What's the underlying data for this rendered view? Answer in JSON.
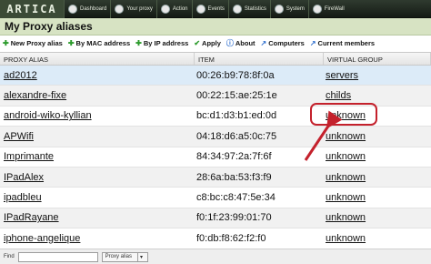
{
  "nav": {
    "logo": "ARTICA",
    "items": [
      {
        "label": "Dashboard",
        "icon": "home-icon"
      },
      {
        "label": "Your proxy",
        "icon": "proxy-icon"
      },
      {
        "label": "Action",
        "icon": "power-icon"
      },
      {
        "label": "Events",
        "icon": "eye-icon"
      },
      {
        "label": "Statistics",
        "icon": "chart-icon"
      },
      {
        "label": "System",
        "icon": "system-icon"
      },
      {
        "label": "FireWall",
        "icon": "firewall-icon"
      }
    ]
  },
  "page": {
    "title": "My Proxy aliases"
  },
  "toolbar": {
    "new_alias": "New Proxy alias",
    "by_mac": "By MAC address",
    "by_ip": "By IP address",
    "apply": "Apply",
    "about": "About",
    "computers": "Computers",
    "members": "Current members"
  },
  "table": {
    "headers": [
      "PROXY ALIAS",
      "ITEM",
      "VIRTUAL GROUP"
    ],
    "rows": [
      {
        "alias": "ad2012",
        "item": "00:26:b9:78:8f:0a",
        "group": "servers"
      },
      {
        "alias": "alexandre-fixe",
        "item": "00:22:15:ae:25:1e",
        "group": "childs"
      },
      {
        "alias": "android-wiko-kyllian",
        "item": "bc:d1:d3:b1:ed:0d",
        "group": "unknown"
      },
      {
        "alias": "APWifi",
        "item": "04:18:d6:a5:0c:75",
        "group": "unknown"
      },
      {
        "alias": "Imprimante",
        "item": "84:34:97:2a:7f:6f",
        "group": "unknown"
      },
      {
        "alias": "IPadAlex",
        "item": "28:6a:ba:53:f3:f9",
        "group": "unknown"
      },
      {
        "alias": "ipadbleu",
        "item": "c8:bc:c8:47:5e:34",
        "group": "unknown"
      },
      {
        "alias": "IPadRayane",
        "item": "f0:1f:23:99:01:70",
        "group": "unknown"
      },
      {
        "alias": "iphone-angelique",
        "item": "f0:db:f8:62:f2:f0",
        "group": "unknown"
      }
    ]
  },
  "footer": {
    "find_label": "Find",
    "find_value": "",
    "select_value": "Proxy alias"
  },
  "colors": {
    "callout": "#c4212c",
    "selected_row": "#dcebf8",
    "title_bar": "#d7e3c3"
  }
}
